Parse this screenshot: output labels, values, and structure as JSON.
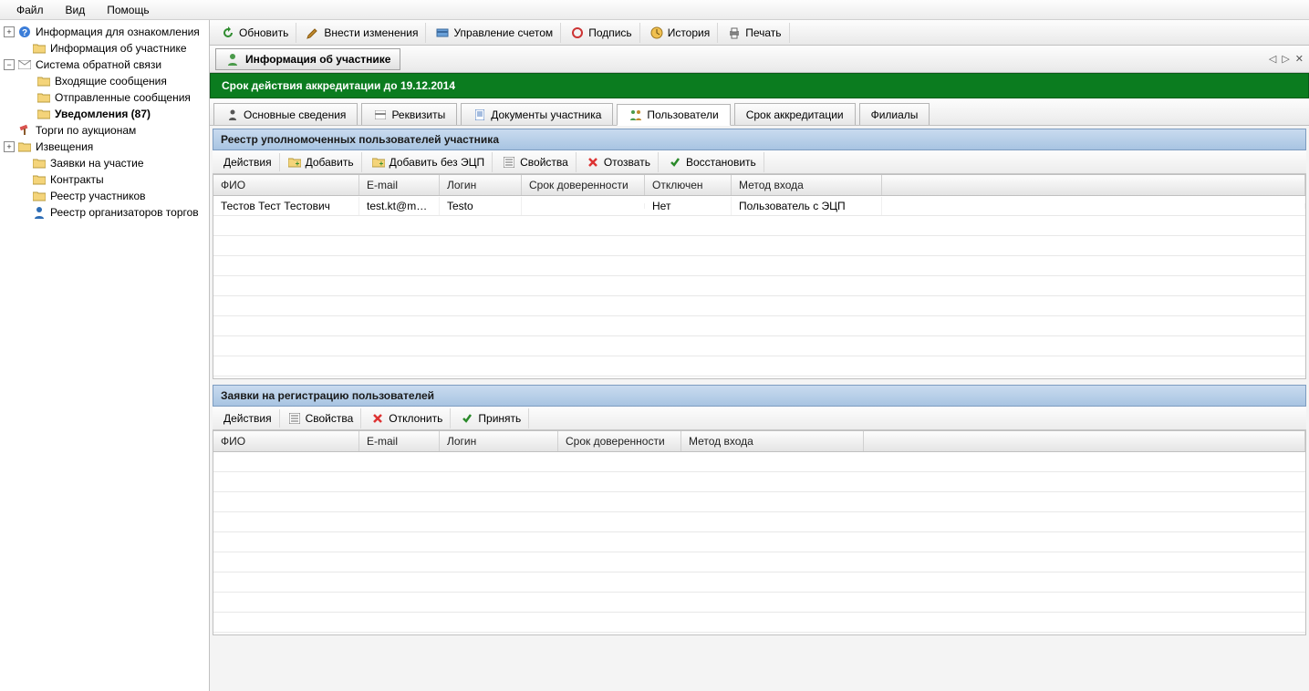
{
  "menu": {
    "file": "Файл",
    "view": "Вид",
    "help": "Помощь"
  },
  "sidebar": {
    "items": [
      {
        "label": "Информация для ознакомления",
        "icon": "ℹ️",
        "toggle": "+"
      },
      {
        "label": "Информация об участнике",
        "icon": "📁",
        "toggle": ""
      },
      {
        "label": "Система обратной связи",
        "icon": "✉️",
        "toggle": "−"
      },
      {
        "label": "Входящие сообщения",
        "icon": "📁",
        "indent": 2
      },
      {
        "label": "Отправленные сообщения",
        "icon": "📁",
        "indent": 2
      },
      {
        "label": "Уведомления (87)",
        "icon": "📁",
        "indent": 2,
        "bold": true
      },
      {
        "label": "Торги по аукционам",
        "icon": "🔨",
        "toggle": ""
      },
      {
        "label": "Извещения",
        "icon": "📁",
        "toggle": "+"
      },
      {
        "label": "Заявки на участие",
        "icon": "📁",
        "toggle": ""
      },
      {
        "label": "Контракты",
        "icon": "📁",
        "toggle": ""
      },
      {
        "label": "Реестр участников",
        "icon": "📁",
        "toggle": ""
      },
      {
        "label": "Реестр организаторов торгов",
        "icon": "👤",
        "toggle": ""
      }
    ]
  },
  "toolbar": {
    "refresh": "Обновить",
    "edit": "Внести изменения",
    "account": "Управление счетом",
    "sign": "Подпись",
    "history": "История",
    "print": "Печать"
  },
  "docTitle": "Информация об участнике",
  "banner": "Срок действия аккредитации до 19.12.2014",
  "tabs": {
    "main": "Основные сведения",
    "requisites": "Реквизиты",
    "documents": "Документы участника",
    "users": "Пользователи",
    "accreditation": "Срок аккредитации",
    "branches": "Филиалы"
  },
  "section1": {
    "title": "Реестр уполномоченных пользователей участника",
    "actionsLabel": "Действия",
    "actions": {
      "add": "Добавить",
      "addNoEcp": "Добавить без ЭЦП",
      "props": "Свойства",
      "revoke": "Отозвать",
      "restore": "Восстановить"
    },
    "columns": {
      "fio": "ФИО",
      "email": "E-mail",
      "login": "Логин",
      "poa": "Срок доверенности",
      "disabled": "Отключен",
      "method": "Метод входа"
    },
    "rows": [
      {
        "fio": "Тестов Тест Тестович",
        "email": "test.kt@mai...",
        "login": "Testo",
        "poa": "",
        "disabled": "Нет",
        "method": "Пользователь с ЭЦП"
      }
    ]
  },
  "section2": {
    "title": "Заявки на регистрацию пользователей",
    "actionsLabel": "Действия",
    "actions": {
      "props": "Свойства",
      "reject": "Отклонить",
      "accept": "Принять"
    },
    "columns": {
      "fio": "ФИО",
      "email": "E-mail",
      "login": "Логин",
      "poa": "Срок доверенности",
      "method": "Метод входа"
    }
  }
}
